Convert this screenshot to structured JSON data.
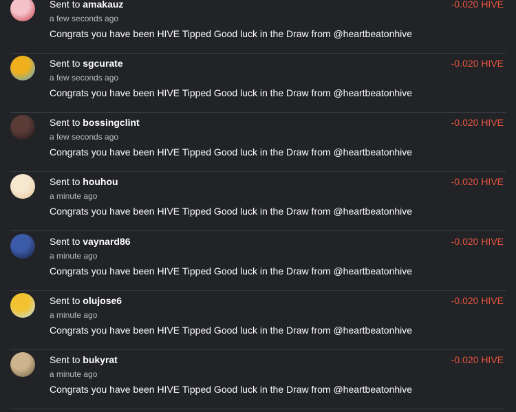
{
  "transfers": [
    {
      "prefix": "Sent to",
      "user": "amakauz",
      "time": "a few seconds ago",
      "memo": "Congrats you have been HIVE Tipped Good luck in the Draw from @heartbeatonhive",
      "amount": "-0.020 HIVE",
      "avatar_colors": [
        "#f4c2c8",
        "#c83a4a"
      ]
    },
    {
      "prefix": "Sent to",
      "user": "sgcurate",
      "time": "a few seconds ago",
      "memo": "Congrats you have been HIVE Tipped Good luck in the Draw from @heartbeatonhive",
      "amount": "-0.020 HIVE",
      "avatar_colors": [
        "#f0b01e",
        "#4fa9d9"
      ]
    },
    {
      "prefix": "Sent to",
      "user": "bossingclint",
      "time": "a few seconds ago",
      "memo": "Congrats you have been HIVE Tipped Good luck in the Draw from @heartbeatonhive",
      "amount": "-0.020 HIVE",
      "avatar_colors": [
        "#5a3b36",
        "#1b1618"
      ]
    },
    {
      "prefix": "Sent to",
      "user": "houhou",
      "time": "a minute ago",
      "memo": "Congrats you have been HIVE Tipped Good luck in the Draw from @heartbeatonhive",
      "amount": "-0.020 HIVE",
      "avatar_colors": [
        "#f6e7cf",
        "#e8c49b"
      ]
    },
    {
      "prefix": "Sent to",
      "user": "vaynard86",
      "time": "a minute ago",
      "memo": "Congrats you have been HIVE Tipped Good luck in the Draw from @heartbeatonhive",
      "amount": "-0.020 HIVE",
      "avatar_colors": [
        "#3b5aa8",
        "#1a1f3a"
      ]
    },
    {
      "prefix": "Sent to",
      "user": "olujose6",
      "time": "a minute ago",
      "memo": "Congrats you have been HIVE Tipped Good luck in the Draw from @heartbeatonhive",
      "amount": "-0.020 HIVE",
      "avatar_colors": [
        "#f2c230",
        "#bfe0ef"
      ]
    },
    {
      "prefix": "Sent to",
      "user": "bukyrat",
      "time": "a minute ago",
      "memo": "Congrats you have been HIVE Tipped Good luck in the Draw from @heartbeatonhive",
      "amount": "-0.020 HIVE",
      "avatar_colors": [
        "#cdb48e",
        "#6b5a3f"
      ]
    }
  ]
}
